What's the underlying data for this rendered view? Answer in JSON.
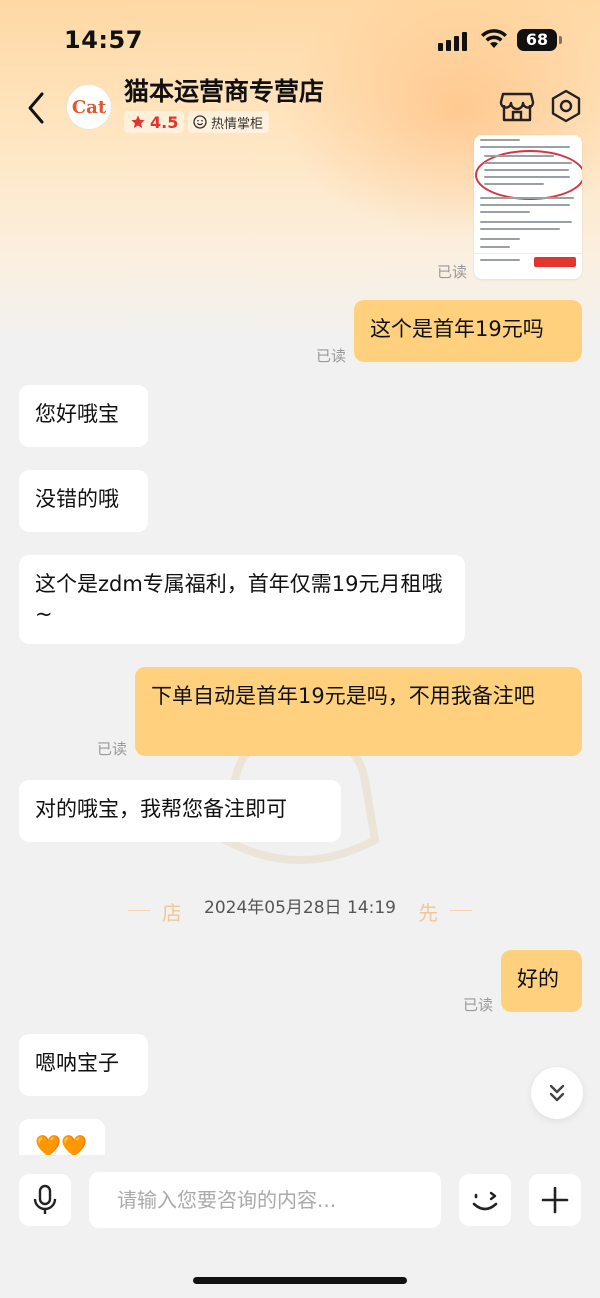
{
  "status_bar": {
    "time": "14:57",
    "battery": "68"
  },
  "header": {
    "shop_name": "猫本运营商专营店",
    "rating": "4.5",
    "badge": "热情掌柜",
    "avatar_text": "Cat"
  },
  "messages": [
    {
      "from": "shop",
      "text": "您好哦宝"
    },
    {
      "from": "shop",
      "text": "没错的哦"
    },
    {
      "from": "shop",
      "text": "这个是zdm专属福利，首年仅需19元月租哦~"
    },
    {
      "from": "user",
      "text": "这个是首年19元吗",
      "status": "已读"
    },
    {
      "from": "user",
      "text": "下单自动是首年19元是吗，不用我备注吧",
      "status": "已读"
    },
    {
      "from": "shop",
      "text": "对的哦宝，我帮您备注即可"
    },
    {
      "from": "user",
      "text": "好的",
      "status": "已读"
    },
    {
      "from": "shop",
      "text": "嗯呐宝子"
    },
    {
      "from": "shop",
      "text": "🧡🧡"
    }
  ],
  "image_message": {
    "status": "已读"
  },
  "timestamp": "2024年05月28日 14:19",
  "watermark": {
    "left": "店",
    "right": "先"
  },
  "input": {
    "placeholder": "请输入您要咨询的内容..."
  },
  "colors": {
    "outgoing_bubble": "#ffd17f",
    "incoming_bubble": "#ffffff",
    "rating_red": "#e6332a",
    "background": "#f1f1f1"
  },
  "icons": [
    "back-arrow-icon",
    "star-icon",
    "smile-badge-icon",
    "store-icon",
    "hexagon-settings-icon",
    "mic-icon",
    "emoji-icon",
    "plus-icon",
    "double-chevron-down-icon"
  ]
}
